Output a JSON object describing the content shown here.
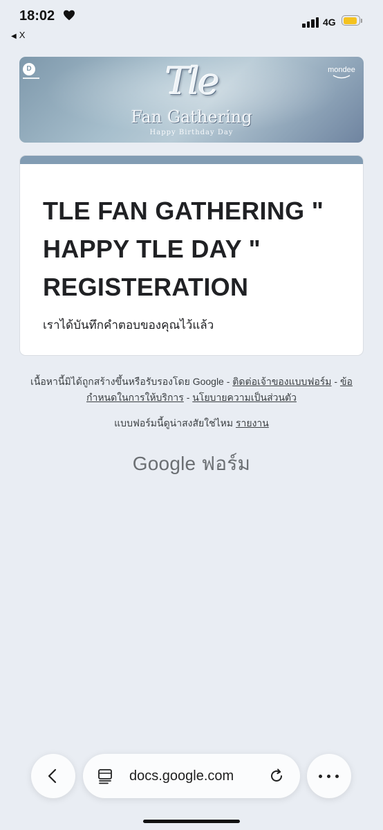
{
  "status_bar": {
    "time": "18:02",
    "back_to_app": "X",
    "network": "4G",
    "battery_color": "#f4c21f"
  },
  "banner": {
    "title": "Tle",
    "subtitle": "Fan Gathering",
    "tagline": "Happy Birthday Day",
    "logo_right": "mondee"
  },
  "form": {
    "accent_color": "#829cb3",
    "title": "TLE FAN GATHERING \" HAPPY TLE DAY \" REGISTERATION",
    "response_message": "เราได้บันทึกคำตอบของคุณไว้แล้ว"
  },
  "footer": {
    "disclaimer_prefix": "เนื้อหานี้มิได้ถูกสร้างขึ้นหรือรับรองโดย Google - ",
    "contact_owner": "ติดต่อเจ้าของแบบฟอร์ม",
    "separator": " - ",
    "terms": "ข้อกำหนดในการให้บริการ",
    "privacy": "นโยบายความเป็นส่วนตัว",
    "report_prefix": "แบบฟอร์มนี้ดูน่าสงสัยใช่ไหม ",
    "report_link": "รายงาน",
    "brand": "Google ฟอร์ม"
  },
  "browser": {
    "url": "docs.google.com"
  }
}
